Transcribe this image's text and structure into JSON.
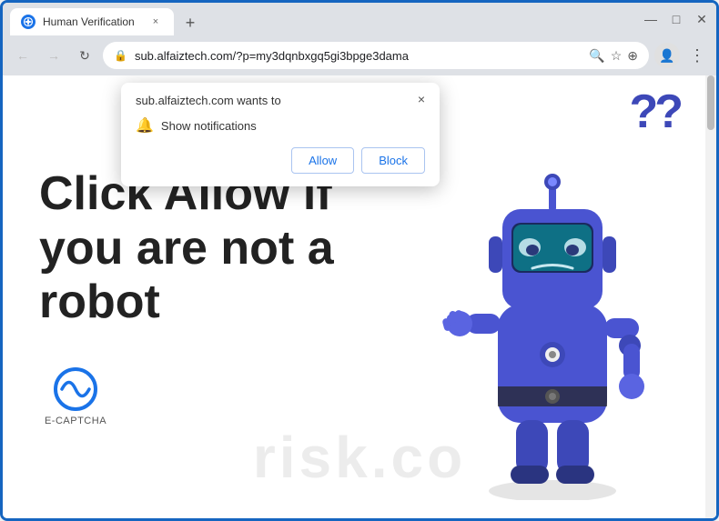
{
  "browser": {
    "tab": {
      "title": "Human Verification",
      "close_label": "×"
    },
    "new_tab_label": "+",
    "window_controls": {
      "minimize": "—",
      "maximize": "□",
      "close": "✕"
    },
    "address_bar": {
      "url": "sub.alfaiztech.com/?p=my3dqnbxgq5gi3bpge3dama",
      "back_label": "←",
      "forward_label": "→",
      "reload_label": "↻"
    }
  },
  "popup": {
    "title": "sub.alfaiztech.com wants to",
    "notification_text": "Show notifications",
    "close_label": "×",
    "allow_label": "Allow",
    "block_label": "Block"
  },
  "website": {
    "main_text": "Click Allow if you are not a robot",
    "ecaptcha_label": "E-CAPTCHA",
    "watermark_text": "risk.co"
  },
  "question_marks": "??"
}
